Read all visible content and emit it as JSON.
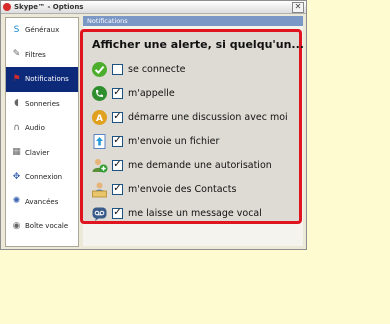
{
  "window": {
    "title": "Skype™ - Options",
    "close_glyph": "✕"
  },
  "sidebar": {
    "items": [
      {
        "label": "Généraux",
        "icon": "skype-logo-icon",
        "glyph": "S",
        "color": "#1a8cd8",
        "active": false
      },
      {
        "label": "Filtres",
        "icon": "tool-icon",
        "glyph": "✎",
        "color": "#666666",
        "active": false
      },
      {
        "label": "Notifications",
        "icon": "flag-icon",
        "glyph": "⚑",
        "color": "#d62b2b",
        "active": true
      },
      {
        "label": "Sonneries",
        "icon": "speaker-icon",
        "glyph": "◖",
        "color": "#666666",
        "active": false
      },
      {
        "label": "Audio",
        "icon": "headset-icon",
        "glyph": "∩",
        "color": "#666666",
        "active": false
      },
      {
        "label": "Clavier",
        "icon": "keyboard-icon",
        "glyph": "▦",
        "color": "#666666",
        "active": false
      },
      {
        "label": "Connexion",
        "icon": "network-icon",
        "glyph": "✥",
        "color": "#3a64b0",
        "active": false
      },
      {
        "label": "Avancées",
        "icon": "advanced-gear-icon",
        "glyph": "✺",
        "color": "#3a64b0",
        "active": false
      },
      {
        "label": "Boîte vocale",
        "icon": "voicemail-icon",
        "glyph": "◉",
        "color": "#666666",
        "active": false
      }
    ]
  },
  "section_header": "Notifications",
  "alerts": {
    "title": "Afficher une alerte, si quelqu'un...",
    "options": [
      {
        "label": "se connecte",
        "checked": false,
        "icon": "online-status-icon"
      },
      {
        "label": "m'appelle",
        "checked": true,
        "icon": "incoming-call-icon"
      },
      {
        "label": "démarre une discussion avec moi",
        "checked": true,
        "icon": "chat-icon"
      },
      {
        "label": "m'envoie un fichier",
        "checked": true,
        "icon": "file-transfer-icon"
      },
      {
        "label": "me demande une autorisation",
        "checked": true,
        "icon": "authorization-request-icon"
      },
      {
        "label": "m'envoie des Contacts",
        "checked": true,
        "icon": "contacts-icon"
      },
      {
        "label": "me laisse un message vocal",
        "checked": true,
        "icon": "voicemail-message-icon"
      }
    ]
  },
  "colors": {
    "highlight_border": "#e0141e",
    "active_item": "#0d2a7a",
    "header_bar": "#7b97c6"
  }
}
